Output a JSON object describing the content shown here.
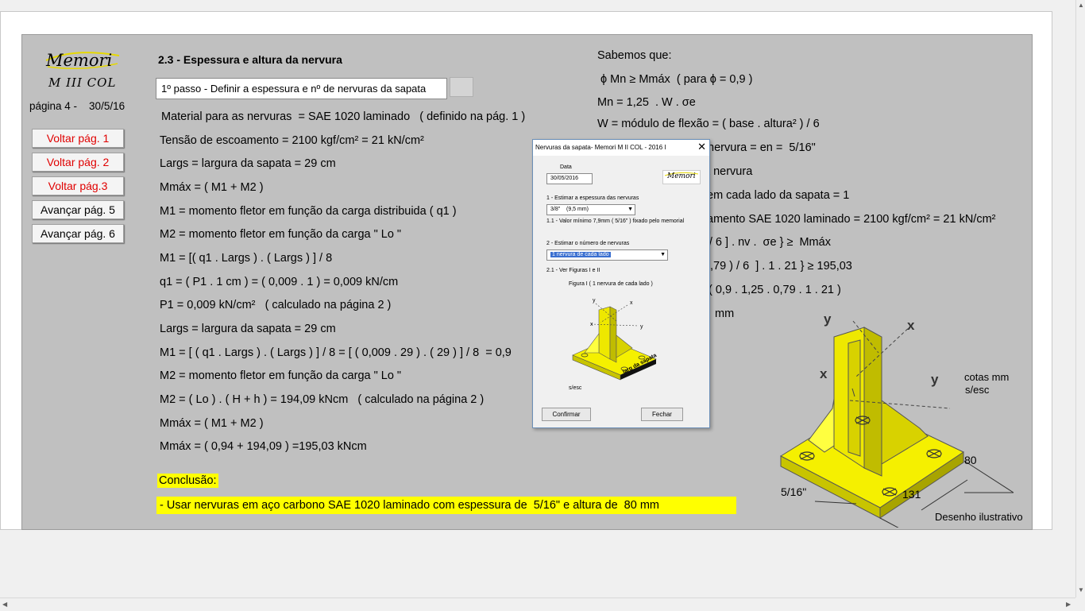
{
  "logo": {
    "brand": "Memori",
    "product": "M III COL"
  },
  "page_info": "página 4 -    30/5/16",
  "nav_buttons": [
    "Voltar pág. 1",
    "Voltar pág. 2",
    "Voltar pág.3",
    "Avançar pág. 5",
    "Avançar pág. 6"
  ],
  "nav_colors": {
    "back": "#e00000",
    "forward": "#000000"
  },
  "section_title": "2.3 - Espessura e altura da nervura",
  "step_field": "1º passo - Definir a espessura e nº de nervuras da sapata",
  "left_lines": [
    "Material para as nervuras  = SAE 1020 laminado   ( definido na pág. 1 )",
    "Tensão de escoamento = 2100 kgf/cm² = 21 kN/cm²",
    "Largs = largura da sapata = 29 cm",
    "Mmáx = ( M1 + M2 )",
    "M1 = momento fletor em função da carga distribuida ( q1 )",
    "M2 = momento fletor em função da carga \" Lo \"",
    "M1 = [( q1 . Largs ) . ( Largs ) ] / 8",
    "q1 = ( P1 . 1 cm ) = ( 0,009 . 1 ) = 0,009 kN/cm",
    "P1 = 0,009 kN/cm²   ( calculado na página 2 )",
    "Largs = largura da sapata = 29 cm",
    "M1 = [ ( q1 . Largs ) . ( Largs ) ] / 8 = [ ( 0,009 . 29 ) . ( 29 ) ] / 8  = 0,9",
    "M2 = momento fletor em função da carga \" Lo \"",
    "M2 = ( Lo ) . ( H + h ) = 194,09 kNcm   ( calculado na página 2 )",
    "Mmáx = ( M1 + M2 )",
    "Mmáx = ( 0,94 + 194,09 ) =195,03 kNcm"
  ],
  "right_lines": [
    "Sabemos que:",
    " ϕ Mn ≥ Mmáx  ( para ϕ = 0,9 )",
    "Mn = 1,25  . W . σe",
    "W = módulo de flexão = ( base . altura² ) / 6",
    "base = espessura da nervura = en =  5/16\"",
    "a nervura",
    "em cada lado da sapata = 1",
    "amento SAE 1020 laminado = 2100 kgf/cm² = 21 kN/cm²",
    ") / 6 ] . nv .  σe } ≥  Mmáx",
    ",79 ) / 6  ] . 1 . 21 } ≥ 195,03",
    "( 0,9 . 1,25 . 0,79 . 1 . 21 )",
    "mm"
  ],
  "conclusion_label": "Conclusão:",
  "conclusion_text": " - Usar nervuras em aço carbono SAE 1020 laminado com espessura de  5/16\" e altura de  80 mm",
  "highlight_color": "#ffff00",
  "drawing": {
    "axis_y": "y",
    "axis_x": "x",
    "cotas": "cotas mm",
    "sesc": "s/esc",
    "dim_80": "80",
    "dim_131": "131",
    "dim_516": "5/16\"",
    "caption": "Desenho ilustrativo",
    "color": "#ffff00"
  },
  "dialog": {
    "title": "Nervuras da sapata- Memori M II COL - 2016 I",
    "date_label": "Data",
    "date_value": "30/05/2016",
    "logo": "Memori",
    "step1_label": "1 - Estimar a espessura das nervuras",
    "thickness_value": "3/8\"    (9,5 mm)",
    "step1_note": "1.1 - Valor mínimo 7,9mm ( 5/16\" ) fixado pelo memorial",
    "step2_label": "2 - Estimar o número de nervuras",
    "ribs_value": "1 nervura de cada lado",
    "step21_label": "2.1 - Ver Figuras I  e II",
    "figure_caption": "Figura I  ( 1 nervura de cada lado )",
    "fig_axis_y": "y",
    "fig_axis_x": "x",
    "fig_label": "larg da sapata",
    "sesc": "s/esc",
    "confirm": "Confirmar",
    "close_btn": "Fechar"
  }
}
